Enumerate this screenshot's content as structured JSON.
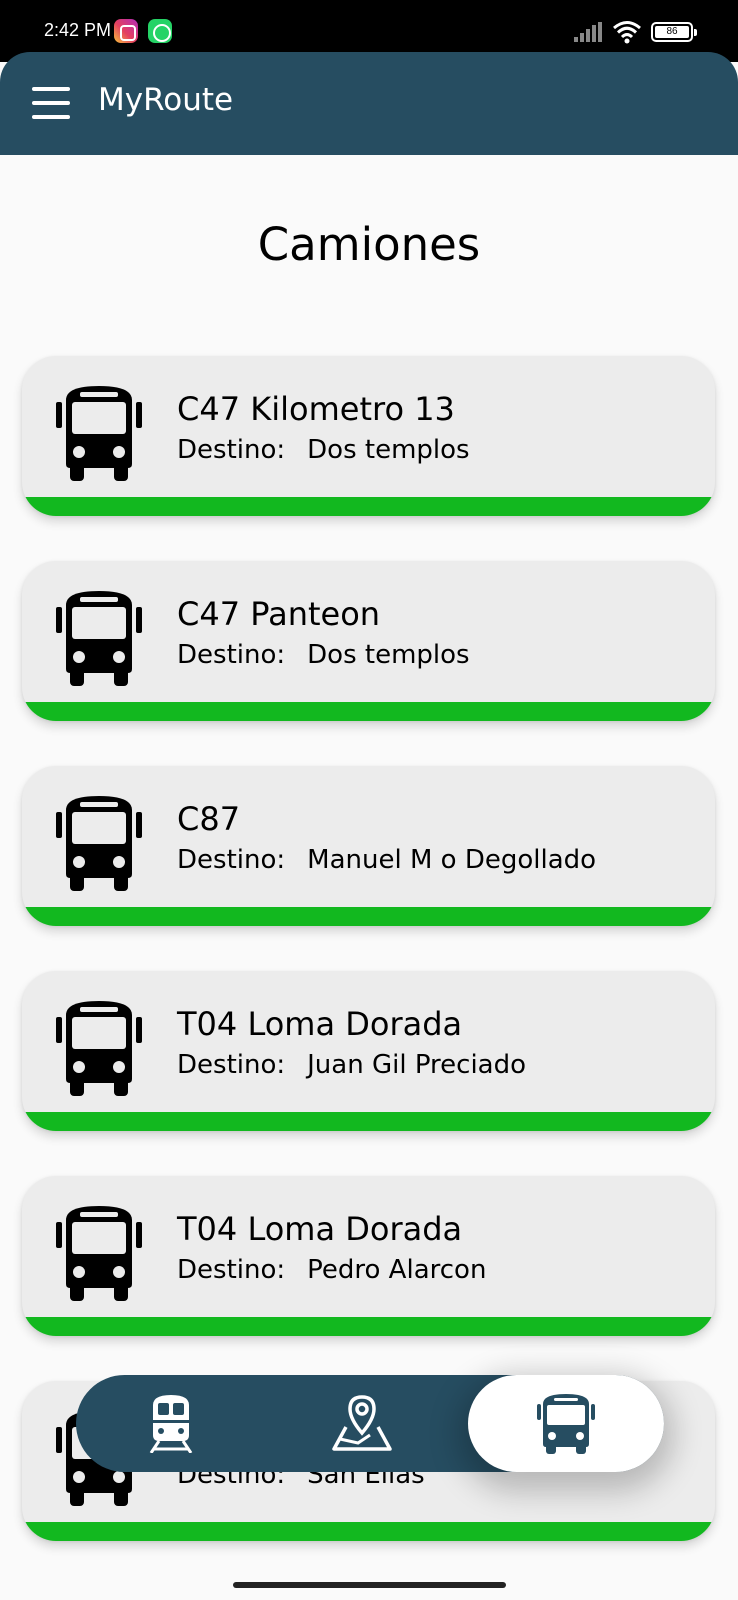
{
  "status_bar": {
    "time": "2:42 PM",
    "battery": "86",
    "icons": [
      "instagram-icon",
      "whatsapp-icon",
      "signal-icon",
      "wifi-icon",
      "battery-icon"
    ]
  },
  "app_bar": {
    "title": "MyRoute",
    "menu_icon": "menu-icon",
    "color": "#264d61"
  },
  "page": {
    "title": "Camiones"
  },
  "routes": [
    {
      "name": "C47 Kilometro 13",
      "destino_label": "Destino:",
      "destino": "Dos templos"
    },
    {
      "name": "C47 Panteon",
      "destino_label": "Destino:",
      "destino": "Dos templos"
    },
    {
      "name": "C87",
      "destino_label": "Destino:",
      "destino": "Manuel M o Degollado"
    },
    {
      "name": "T04 Loma Dorada",
      "destino_label": "Destino:",
      "destino": "Juan Gil Preciado"
    },
    {
      "name": "T04 Loma Dorada",
      "destino_label": "Destino:",
      "destino": "Pedro Alarcon"
    },
    {
      "name": "",
      "destino_label": "Destino:",
      "destino": "San Elias"
    }
  ],
  "bottom_nav": {
    "items": [
      {
        "icon": "train-icon",
        "selected": false
      },
      {
        "icon": "map-pin-icon",
        "selected": false
      },
      {
        "icon": "bus-icon",
        "selected": true
      }
    ]
  },
  "colors": {
    "accent_bar": "#12b81f",
    "card_bg": "#ececec",
    "primary": "#264d61"
  }
}
